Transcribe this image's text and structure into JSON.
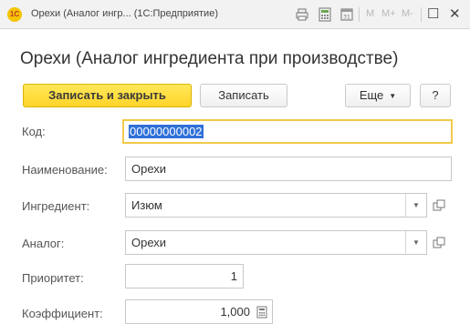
{
  "window": {
    "logo": "1С",
    "title": "Орехи (Аналог ингр... (1С:Предприятие)",
    "toolbar": {
      "m": "M",
      "m_plus": "M+",
      "m_minus": "M-",
      "restore": "☐",
      "close": "✕"
    }
  },
  "form": {
    "title": "Орехи (Аналог ингредиента при производстве)"
  },
  "commandbar": {
    "save_close": "Записать и закрыть",
    "save": "Записать",
    "more": "Еще",
    "help": "?"
  },
  "fields": {
    "code": {
      "label": "Код:",
      "value": "00000000002"
    },
    "name": {
      "label": "Наименование:",
      "value": "Орехи"
    },
    "ingredient": {
      "label": "Ингредиент:",
      "value": "Изюм"
    },
    "analog": {
      "label": "Аналог:",
      "value": "Орехи"
    },
    "priority": {
      "label": "Приоритет:",
      "value": "1"
    },
    "coefficient": {
      "label": "Коэффициент:",
      "value": "1,000"
    }
  },
  "colors": {
    "primary_button": "#ffd42a",
    "focus_border": "#f1c94b",
    "selection": "#3070d8"
  },
  "icons": [
    "logo-icon",
    "print-icon",
    "calculator-icon",
    "calendar-icon",
    "chevron-down-icon",
    "open-icon"
  ]
}
